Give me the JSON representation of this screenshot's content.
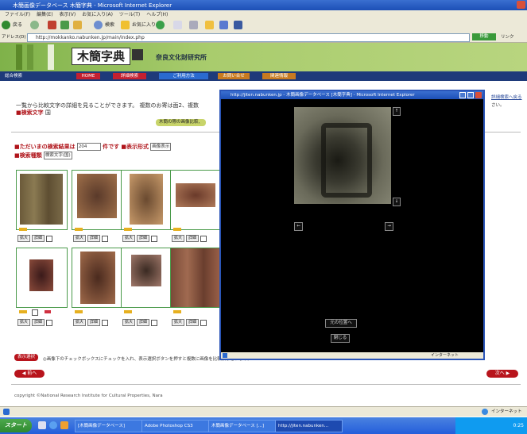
{
  "window": {
    "title": "木簡画像データベース 木簡字典 - Microsoft Internet Explorer"
  },
  "menu": [
    "ファイル(F)",
    "編集(E)",
    "表示(V)",
    "お気に入り(A)",
    "ツール(T)",
    "ヘルプ(H)"
  ],
  "toolbar": {
    "back": "戻る",
    "search": "検索",
    "favorites": "お気に入り"
  },
  "address": {
    "label": "アドレス(D)",
    "url": "http://mokkanko.nabunken.jp/main/index.php",
    "go": "移動",
    "links": "リンク"
  },
  "site": {
    "logo": "木簡字典",
    "org": "奈良文化財研究所"
  },
  "nav": [
    "総合検索",
    "HOME",
    "詳細検索",
    "ご利用方法",
    "お問い合せ",
    "関連情報"
  ],
  "intro": {
    "line1": "一覧から比較文字の詳細を見ることができます。 複数のお寄は面2、複数",
    "line2": "に",
    "side": "詳細検索へ戻る",
    "side2": "さい。"
  },
  "search_term_label": "■検索文字",
  "search_term": "国",
  "note_pill": "木簡の際の画像比較、",
  "results": {
    "prefix": "■ただいまの検索結果は",
    "count": "204",
    "suffix": "件です",
    "display_label": "■表示形式",
    "display_value": "画像表示",
    "sort_label": "■検索種類",
    "sort_value": "検索文字(国)"
  },
  "thumb_buttons": {
    "enlarge": "拡大",
    "detail": "詳細"
  },
  "bottom": {
    "select_all": "表示選択",
    "instruction": "◎画像下のチェックボックスにチェックを入れ、表示選択ボタンを押すと複数に画像を比較表示されます。",
    "prev": "◀ 前へ",
    "next": "次へ ▶",
    "copyright": "copyright ©National Research Institute for Cultural Properties, Nara"
  },
  "popup": {
    "title": "http://jiten.nabunken.jp - 木簡画像データベース [木簡字典] - Microsoft Internet Explorer",
    "up": "↑",
    "down": "↓",
    "left": "←",
    "right": "→",
    "reset": "元の位置へ",
    "close": "閉じる",
    "status": "インターネット"
  },
  "statusbar": {
    "right": "インターネット"
  },
  "taskbar": {
    "start": "スタート",
    "tasks": [
      "[木簡画像データベース]",
      "Adobe Photoshop CS3",
      "木簡画像データベース [...]",
      "http://jiten.nabunken..."
    ],
    "clock": "0:25"
  }
}
